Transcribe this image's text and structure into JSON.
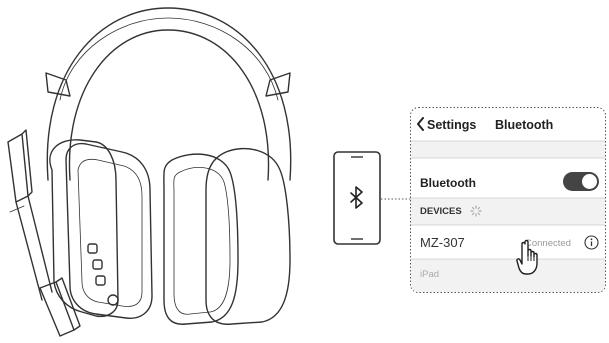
{
  "header": {
    "back_label": "Settings",
    "title": "Bluetooth"
  },
  "bluetooth_row": {
    "label": "Bluetooth",
    "toggle_on": true
  },
  "devices_section": {
    "label": "DEVICES"
  },
  "devices": [
    {
      "name": "MZ-307",
      "status": "Connected"
    },
    {
      "name": "iPad",
      "status": ""
    }
  ],
  "icons": {
    "phone": "bluetooth-icon",
    "back": "chevron-left-icon",
    "info": "info-icon",
    "spinner": "loading-spinner-icon",
    "hand": "pointing-hand-icon"
  },
  "colors": {
    "line": "#333333",
    "muted": "#999999",
    "dotted": "#555555"
  }
}
